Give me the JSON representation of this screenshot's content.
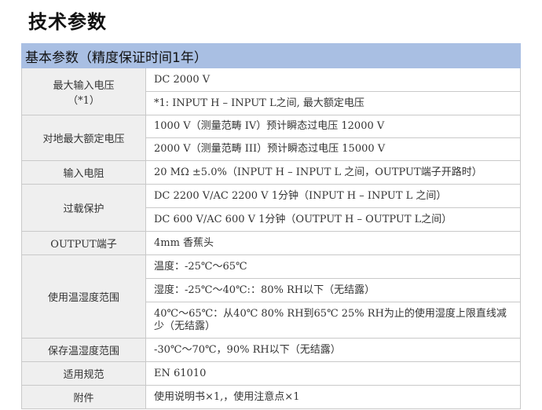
{
  "page_title": "技术参数",
  "table_header": "基本参数（精度保证时间1年）",
  "rows": {
    "max_input_voltage": {
      "label": "最大输入电压",
      "label_note": "（*1）",
      "values": [
        "DC 2000 V",
        "*1: INPUT H – INPUT L之间, 最大额定电压"
      ]
    },
    "ground_max_voltage": {
      "label": "对地最大额定电压",
      "values": [
        "1000 V（测量范畴 IV）预计瞬态过电压 12000 V",
        "2000 V（测量范畴 III）预计瞬态过电压 15000 V"
      ]
    },
    "input_resistance": {
      "label": "输入电阻",
      "values": [
        "20 MΩ ±5.0%（INPUT H – INPUT L 之间，OUTPUT端子开路时）"
      ]
    },
    "overload_protection": {
      "label": "过载保护",
      "values": [
        "DC 2200 V/AC 2200 V 1分钟（INPUT H – INPUT L 之间）",
        "DC 600 V/AC 600 V 1分钟（OUTPUT H – OUTPUT L之间）"
      ]
    },
    "output_terminal": {
      "label": "OUTPUT端子",
      "values": [
        "4mm 香蕉头"
      ]
    },
    "operating_env": {
      "label": "使用温湿度范围",
      "values": [
        "温度：-25℃～65℃",
        "湿度：-25℃～40℃:：80% RH以下（无结露）",
        "40℃～65℃：从40℃ 80% RH到65℃ 25% RH为止的使用湿度上限直线减少（无结露）"
      ]
    },
    "storage_env": {
      "label": "保存温湿度范围",
      "values": [
        "-30℃～70℃，90% RH以下（无结露）"
      ]
    },
    "standards": {
      "label": "适用规范",
      "values": [
        "EN 61010"
      ]
    },
    "accessories": {
      "label": "附件",
      "values": [
        "使用说明书×1,，使用注意点×1"
      ]
    }
  }
}
